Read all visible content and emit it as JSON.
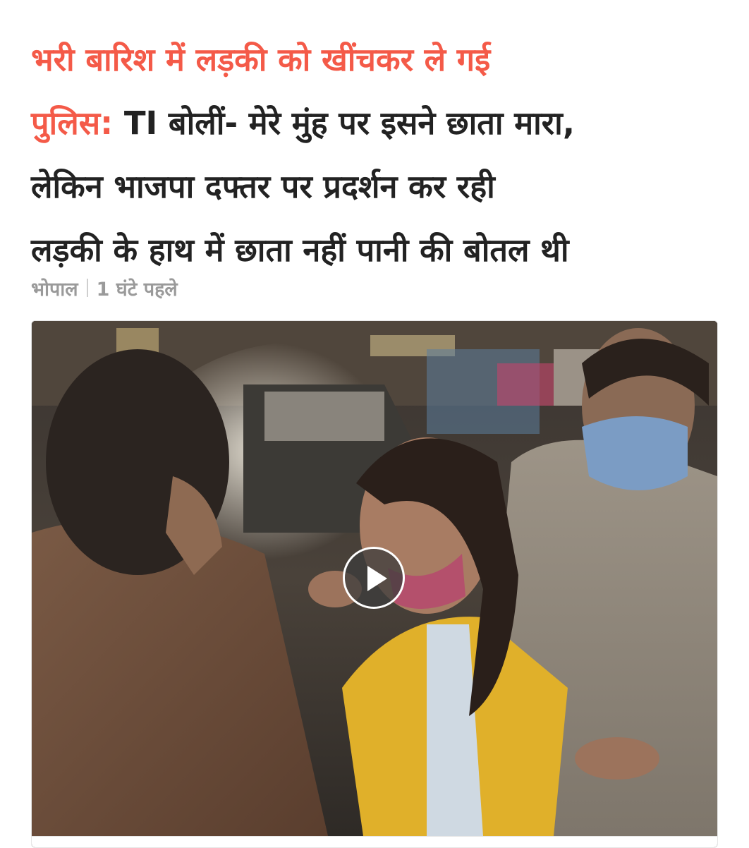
{
  "headline": {
    "highlight_lines": [
      "भरी बारिश में लड़की को खींचकर ले गई",
      "पुलिस:"
    ],
    "rest_first": "TI बोलीं- मेरे मुंह पर इसने छाता मारा,",
    "rest_lines": [
      "लेकिन भाजपा दफ्तर पर प्रदर्शन कर रही",
      "लड़की के हाथ में छाता नहीं पानी की बोतल थी"
    ]
  },
  "meta": {
    "location": "भोपाल",
    "time": "1 घंटे पहले"
  },
  "media": {
    "type": "video",
    "play_icon": "play-icon"
  },
  "colors": {
    "headline_accent": "#f45a48",
    "headline_text": "#222222",
    "meta_text": "#9a9a9a"
  }
}
